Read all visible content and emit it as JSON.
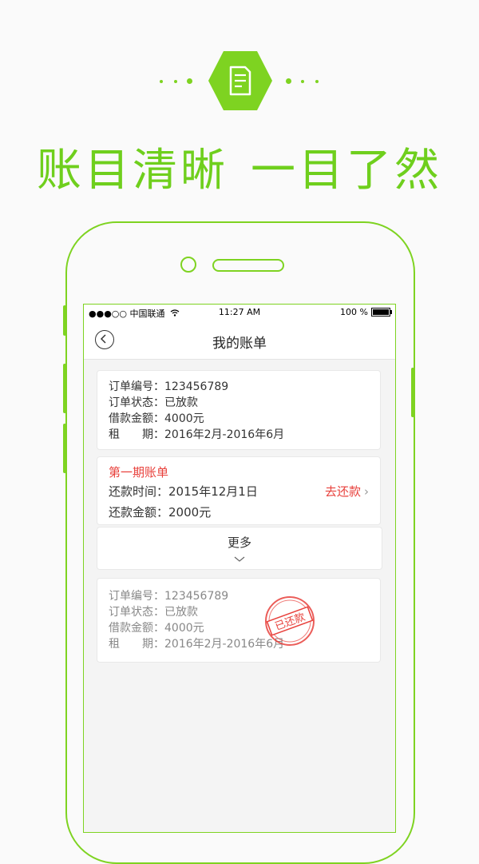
{
  "hero": {
    "icon": "document-icon",
    "headline_part1": "账目清晰",
    "headline_part2": "一目了然"
  },
  "status_bar": {
    "carrier": "●●●○○ 中国联通",
    "time": "11:27 AM",
    "battery": "100 %"
  },
  "nav": {
    "title": "我的账单"
  },
  "order_card": {
    "order_no_label": "订单编号：",
    "order_no": "123456789",
    "status_label": "订单状态：",
    "status": "已放款",
    "amount_label": "借款金额：",
    "amount": "4000元",
    "period_label": "租　　期：",
    "period": "2016年2月-2016年6月"
  },
  "bill_card": {
    "title": "第一期账单",
    "time_label": "还款时间：",
    "time": "2015年12月1日",
    "amount_label": "还款金额：",
    "amount": "2000元",
    "repay_link": "去还款"
  },
  "more": {
    "label": "更多"
  },
  "paid_card": {
    "order_no_label": "订单编号：",
    "order_no": "123456789",
    "status_label": "订单状态：",
    "status": "已放款",
    "amount_label": "借款金额：",
    "amount": "4000元",
    "period_label": "租　　期：",
    "period": "2016年2月-2016年6月",
    "stamp": "已还款"
  },
  "colors": {
    "accent": "#7ed321",
    "alert": "#e8413c"
  }
}
